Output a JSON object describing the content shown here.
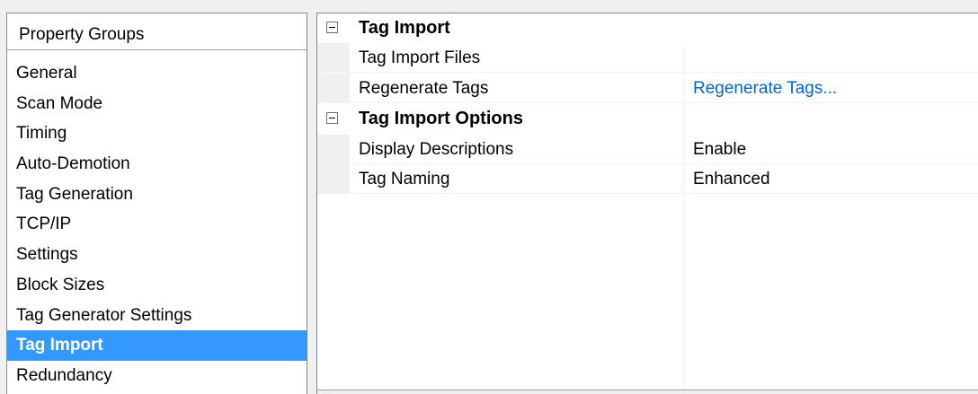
{
  "property_groups": {
    "header": "Property Groups",
    "items": [
      {
        "label": "General",
        "selected": false
      },
      {
        "label": "Scan Mode",
        "selected": false
      },
      {
        "label": "Timing",
        "selected": false
      },
      {
        "label": "Auto-Demotion",
        "selected": false
      },
      {
        "label": "Tag Generation",
        "selected": false
      },
      {
        "label": "TCP/IP",
        "selected": false
      },
      {
        "label": "Settings",
        "selected": false
      },
      {
        "label": "Block Sizes",
        "selected": false
      },
      {
        "label": "Tag Generator Settings",
        "selected": false
      },
      {
        "label": "Tag Import",
        "selected": true
      },
      {
        "label": "Redundancy",
        "selected": false
      }
    ]
  },
  "properties": {
    "tag_import": {
      "category_label": "Tag Import",
      "rows": [
        {
          "name": "Tag Import Files",
          "value": ""
        },
        {
          "name": "Regenerate Tags",
          "value": "Regenerate Tags..."
        }
      ]
    },
    "tag_import_options": {
      "category_label": "Tag Import Options",
      "rows": [
        {
          "name": "Display Descriptions",
          "value": "Enable"
        },
        {
          "name": "Tag Naming",
          "value": "Enhanced"
        }
      ]
    }
  },
  "colors": {
    "selection": "#3399ff",
    "link": "#0066cc",
    "gutter": "#f0f0f0"
  }
}
